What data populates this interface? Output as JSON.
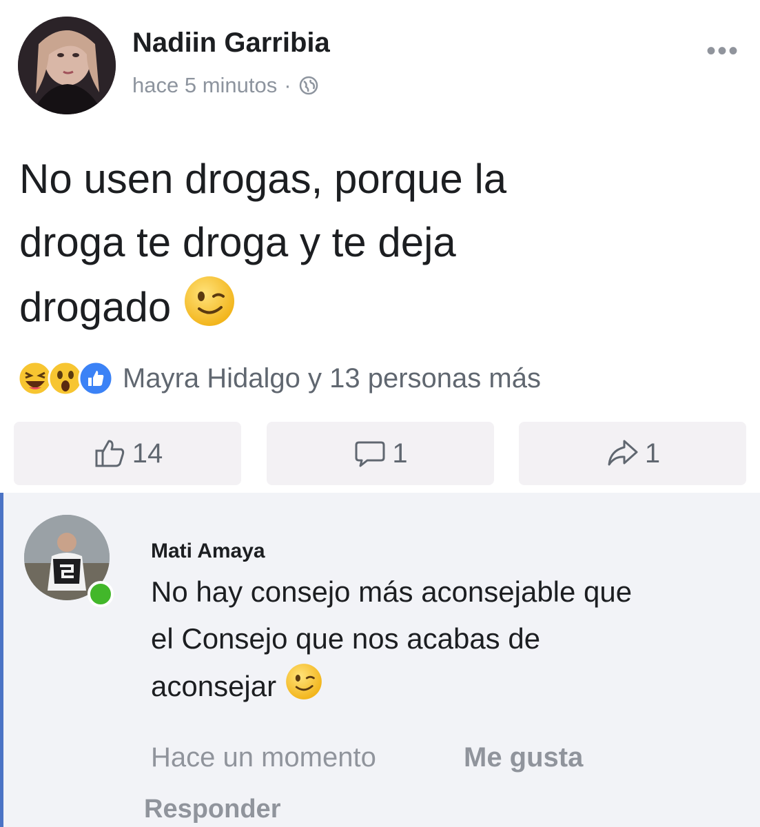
{
  "post": {
    "author": "Nadiin Garribia",
    "time": "hace 5 minutos",
    "separator": "·",
    "privacy_icon": "globe-icon",
    "more_label": "•••",
    "text_lines": [
      "No usen drogas, porque la",
      "droga te droga y te deja",
      "drogado"
    ],
    "text_emoji": "winking-face-emoji",
    "reactions": {
      "icons": [
        "laughing-reaction-icon",
        "wow-reaction-icon",
        "like-reaction-icon"
      ],
      "summary": "Mayra Hidalgo y 13 personas más"
    },
    "actions": {
      "like_count": "14",
      "comment_count": "1",
      "share_count": "1"
    }
  },
  "comment": {
    "author": "Mati Amaya",
    "text_lines": [
      "No hay consejo más aconsejable que",
      "el Consejo que nos acabas de",
      "aconsejar"
    ],
    "text_emoji": "winking-face-emoji",
    "time": "Hace un momento",
    "like_label": "Me gusta",
    "reply_label": "Responder",
    "online": true
  },
  "colors": {
    "accent_border": "#4b73c5",
    "online_dot": "#42b72a",
    "secondary_text": "#8d949e"
  }
}
